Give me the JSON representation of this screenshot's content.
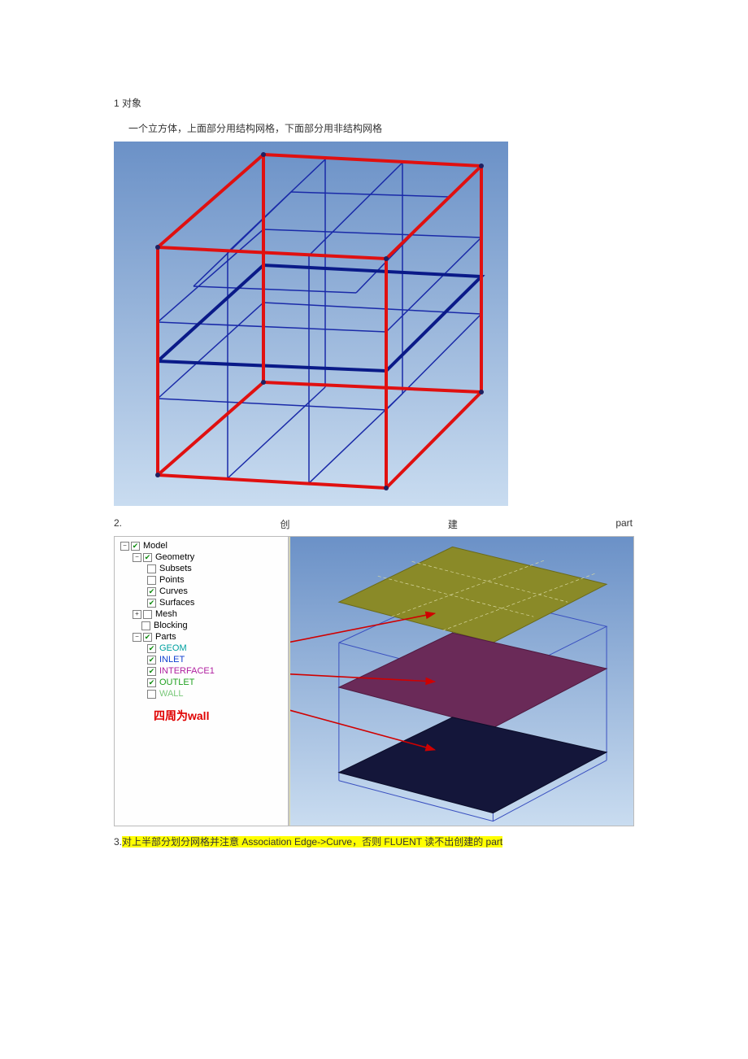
{
  "section1": {
    "heading": "1 对象",
    "desc": "一个立方体，上面部分用结构网格，下面部分用非结构网格"
  },
  "section2": {
    "num": "2.",
    "mid1": "创",
    "mid2": "建",
    "right": "part"
  },
  "tree": {
    "root": "Model",
    "geometry": "Geometry",
    "subsets": "Subsets",
    "points": "Points",
    "curves": "Curves",
    "surfaces": "Surfaces",
    "mesh": "Mesh",
    "blocking": "Blocking",
    "parts": "Parts",
    "geom": "GEOM",
    "inlet": "INLET",
    "interface": "INTERFACE1",
    "outlet": "OUTLET",
    "wall": "WALL",
    "annotation": "四周为wall"
  },
  "section3": {
    "num": "3.",
    "text": "对上半部分划分网格并注意 Association Edge->Curve，否则 FLUENT 读不出创建的 part"
  }
}
